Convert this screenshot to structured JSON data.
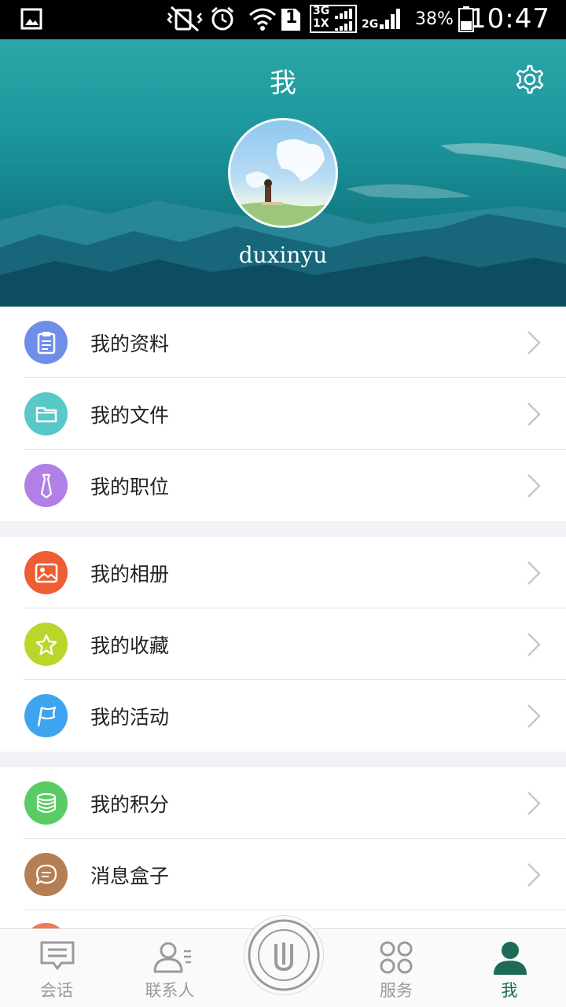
{
  "status_bar": {
    "signal_1_label": "1",
    "network_top": "3G",
    "network_bottom": "1X",
    "network_2": "2G",
    "battery": "38%",
    "time": "10:47",
    "icons": [
      "image-icon",
      "mute-vibrate-icon",
      "alarm-icon",
      "wifi-icon",
      "sim-icon",
      "signal-icon",
      "battery-icon"
    ]
  },
  "header": {
    "title": "我",
    "username": "duxinyu",
    "settings_icon": "gear-icon"
  },
  "menu_groups": [
    [
      {
        "label": "我的资料",
        "icon": "clipboard-icon",
        "color": "#6f8ee8"
      },
      {
        "label": "我的文件",
        "icon": "folder-icon",
        "color": "#58c9c7"
      },
      {
        "label": "我的职位",
        "icon": "tie-icon",
        "color": "#b27fe6"
      }
    ],
    [
      {
        "label": "我的相册",
        "icon": "photo-icon",
        "color": "#ef5d33"
      },
      {
        "label": "我的收藏",
        "icon": "star-icon",
        "color": "#bad62a"
      },
      {
        "label": "我的活动",
        "icon": "flag-icon",
        "color": "#3ea4ef"
      }
    ],
    [
      {
        "label": "我的积分",
        "icon": "coins-icon",
        "color": "#5bcc63"
      },
      {
        "label": "消息盒子",
        "icon": "message-icon",
        "color": "#b57f53"
      }
    ]
  ],
  "bottom_nav": {
    "items": [
      {
        "label": "会话",
        "icon": "chat-icon",
        "active": false
      },
      {
        "label": "联系人",
        "icon": "contacts-icon",
        "active": false
      },
      {
        "label": "",
        "icon": "university-logo-icon",
        "active": false
      },
      {
        "label": "服务",
        "icon": "services-icon",
        "active": false
      },
      {
        "label": "我",
        "icon": "person-icon",
        "active": true
      }
    ],
    "active_color": "#1d6a57",
    "inactive_color": "#9a9a9a"
  }
}
